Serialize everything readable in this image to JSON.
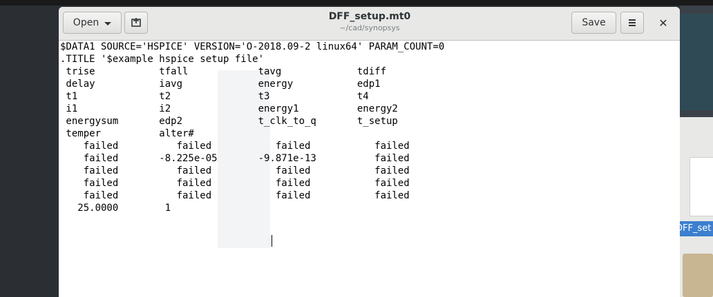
{
  "window": {
    "title": "DFF_setup.mt0",
    "subtitle": "~/cad/synopsys"
  },
  "toolbar": {
    "open_label": "Open",
    "save_label": "Save",
    "close_glyph": "✕"
  },
  "icons": {
    "new_document": "new-document-icon",
    "menu": "hamburger-menu-icon",
    "dropdown": "chevron-down-icon"
  },
  "background": {
    "file_label": "DFF_set"
  },
  "editor": {
    "content": "$DATA1 SOURCE='HSPICE' VERSION='O-2018.09-2 linux64' PARAM_COUNT=0\n.TITLE '$example hspice setup file'\n trise           tfall            tavg             tdiff\n delay           iavg             energy           edp1\n t1              t2               t3               t4\n i1              i2               energy1          energy2\n energysum       edp2             t_clk_to_q       t_setup\n temper          alter#\n    failed          failed           failed           failed\n    failed       -8.225e-05       -9.871e-13          failed\n    failed          failed           failed           failed\n    failed          failed           failed           failed\n    failed          failed           failed           failed\n   25.0000        1"
  }
}
